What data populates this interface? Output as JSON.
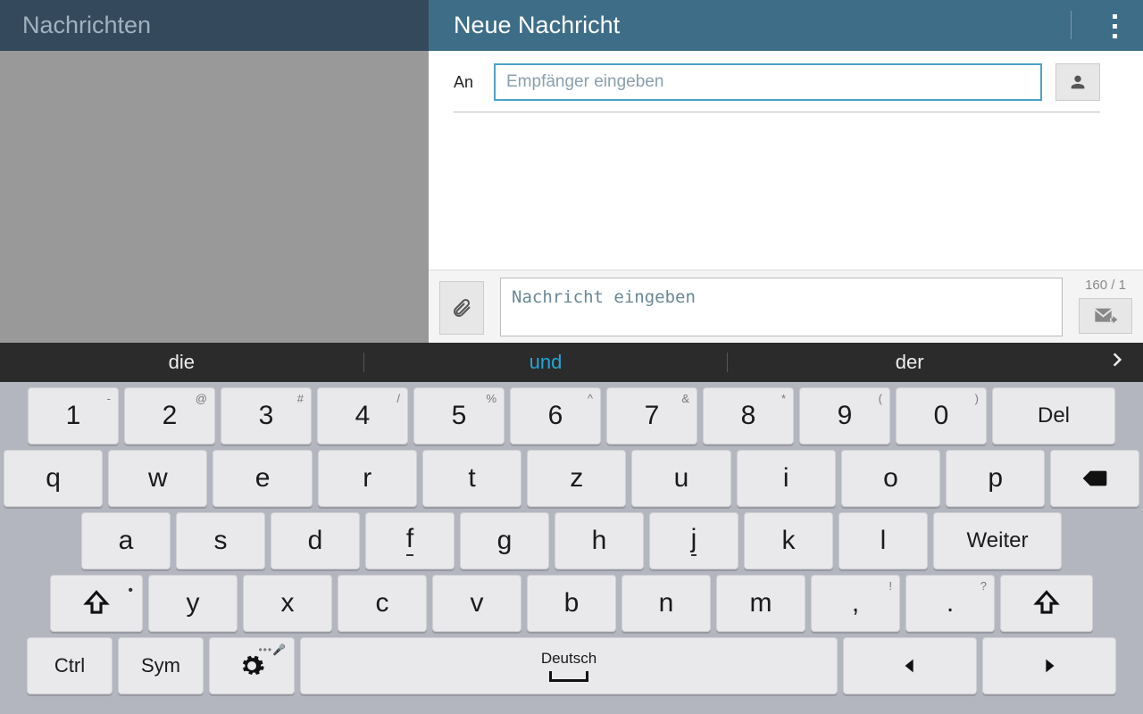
{
  "header": {
    "left_title": "Nachrichten",
    "right_title": "Neue Nachricht"
  },
  "compose": {
    "to_label": "An",
    "to_placeholder": "Empfänger eingeben",
    "msg_placeholder": "Nachricht eingeben",
    "counter": "160 / 1"
  },
  "suggestions": {
    "a": "die",
    "b": "und",
    "c": "der"
  },
  "keys": {
    "num": [
      "1",
      "2",
      "3",
      "4",
      "5",
      "6",
      "7",
      "8",
      "9",
      "0"
    ],
    "numSup": [
      "-",
      "@",
      "#",
      "/",
      "%",
      "^",
      "&",
      "*",
      "(",
      ")"
    ],
    "del": "Del",
    "r2": [
      "q",
      "w",
      "e",
      "r",
      "t",
      "z",
      "u",
      "i",
      "o",
      "p"
    ],
    "r3": [
      "a",
      "s",
      "d",
      "f",
      "g",
      "h",
      "j",
      "k",
      "l"
    ],
    "weiter": "Weiter",
    "r4": [
      "y",
      "x",
      "c",
      "v",
      "b",
      "n",
      "m"
    ],
    "comma": ",",
    "commaSup": "!",
    "dot": ".",
    "dotSup": "?",
    "ctrl": "Ctrl",
    "sym": "Sym",
    "space_label": "Deutsch"
  }
}
